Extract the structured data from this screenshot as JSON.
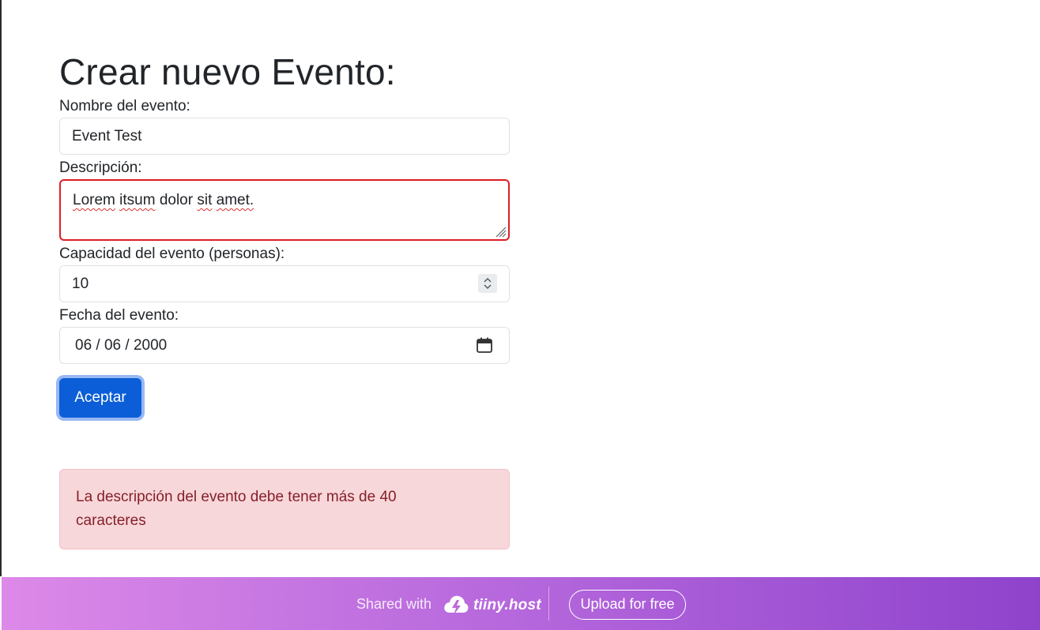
{
  "form": {
    "title": "Crear nuevo Evento:",
    "name_label": "Nombre del evento:",
    "name_value": "Event Test",
    "description_label": "Descripción:",
    "description_words": [
      "Lorem",
      "itsum",
      "dolor",
      "sit",
      "amet."
    ],
    "capacity_label": "Capacidad del evento (personas):",
    "capacity_value": "10",
    "date_label": "Fecha del evento:",
    "date_value": "06 / 06 / 2000",
    "submit_label": "Aceptar"
  },
  "alert": {
    "line1": "La descripción del evento debe tener más de 40",
    "line2": "caracteres"
  },
  "footer": {
    "shared_text": "Shared with",
    "brand": "tiiny.host",
    "upload_label": "Upload for free"
  },
  "colors": {
    "primary": "#0b5ed7",
    "invalid_border": "#dc1f26",
    "alert_bg": "#f8d7da",
    "alert_text": "#842029"
  }
}
